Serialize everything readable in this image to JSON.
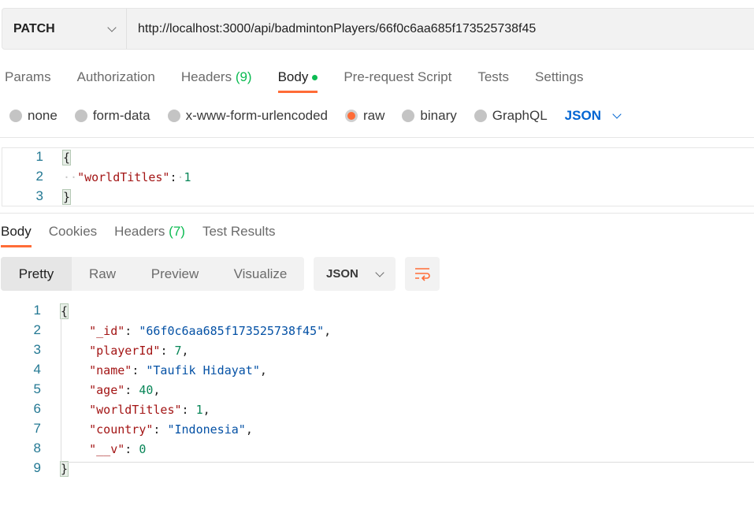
{
  "request": {
    "method": "PATCH",
    "url": "http://localhost:3000/api/badmintonPlayers/66f0c6aa685f173525738f45"
  },
  "request_tabs": [
    {
      "label": "Params"
    },
    {
      "label": "Authorization"
    },
    {
      "label": "Headers",
      "count": "(9)"
    },
    {
      "label": "Body",
      "active": true
    },
    {
      "label": "Pre-request Script"
    },
    {
      "label": "Tests"
    },
    {
      "label": "Settings"
    }
  ],
  "body_types": [
    {
      "label": "none"
    },
    {
      "label": "form-data"
    },
    {
      "label": "x-www-form-urlencoded"
    },
    {
      "label": "raw",
      "selected": true
    },
    {
      "label": "binary"
    },
    {
      "label": "GraphQL"
    }
  ],
  "body_format": "JSON",
  "request_body": [
    [
      {
        "t": "{",
        "c": "p brace"
      }
    ],
    [
      {
        "t": "··",
        "c": "ws"
      },
      {
        "t": "\"worldTitles\"",
        "c": "k"
      },
      {
        "t": ":",
        "c": "p"
      },
      {
        "t": "·",
        "c": "ws"
      },
      {
        "t": "1",
        "c": "n"
      }
    ],
    [
      {
        "t": "}",
        "c": "p brace"
      }
    ]
  ],
  "response_tabs": [
    {
      "label": "Body",
      "active": true
    },
    {
      "label": "Cookies"
    },
    {
      "label": "Headers",
      "count": "(7)"
    },
    {
      "label": "Test Results"
    }
  ],
  "view_modes": [
    "Pretty",
    "Raw",
    "Preview",
    "Visualize"
  ],
  "response_format": "JSON",
  "response_body": [
    [
      {
        "t": "{",
        "c": "p brace"
      }
    ],
    [
      {
        "t": "    "
      },
      {
        "t": "\"_id\"",
        "c": "k"
      },
      {
        "t": ": ",
        "c": "p"
      },
      {
        "t": "\"66f0c6aa685f173525738f45\"",
        "c": "s"
      },
      {
        "t": ",",
        "c": "p"
      }
    ],
    [
      {
        "t": "    "
      },
      {
        "t": "\"playerId\"",
        "c": "k"
      },
      {
        "t": ": ",
        "c": "p"
      },
      {
        "t": "7",
        "c": "n"
      },
      {
        "t": ",",
        "c": "p"
      }
    ],
    [
      {
        "t": "    "
      },
      {
        "t": "\"name\"",
        "c": "k"
      },
      {
        "t": ": ",
        "c": "p"
      },
      {
        "t": "\"Taufik Hidayat\"",
        "c": "s"
      },
      {
        "t": ",",
        "c": "p"
      }
    ],
    [
      {
        "t": "    "
      },
      {
        "t": "\"age\"",
        "c": "k"
      },
      {
        "t": ": ",
        "c": "p"
      },
      {
        "t": "40",
        "c": "n"
      },
      {
        "t": ",",
        "c": "p"
      }
    ],
    [
      {
        "t": "    "
      },
      {
        "t": "\"worldTitles\"",
        "c": "k"
      },
      {
        "t": ": ",
        "c": "p"
      },
      {
        "t": "1",
        "c": "n"
      },
      {
        "t": ",",
        "c": "p"
      }
    ],
    [
      {
        "t": "    "
      },
      {
        "t": "\"country\"",
        "c": "k"
      },
      {
        "t": ": ",
        "c": "p"
      },
      {
        "t": "\"Indonesia\"",
        "c": "s"
      },
      {
        "t": ",",
        "c": "p"
      }
    ],
    [
      {
        "t": "    "
      },
      {
        "t": "\"__v\"",
        "c": "k"
      },
      {
        "t": ": ",
        "c": "p"
      },
      {
        "t": "0",
        "c": "n"
      }
    ],
    [
      {
        "t": "}",
        "c": "p brace"
      }
    ]
  ]
}
